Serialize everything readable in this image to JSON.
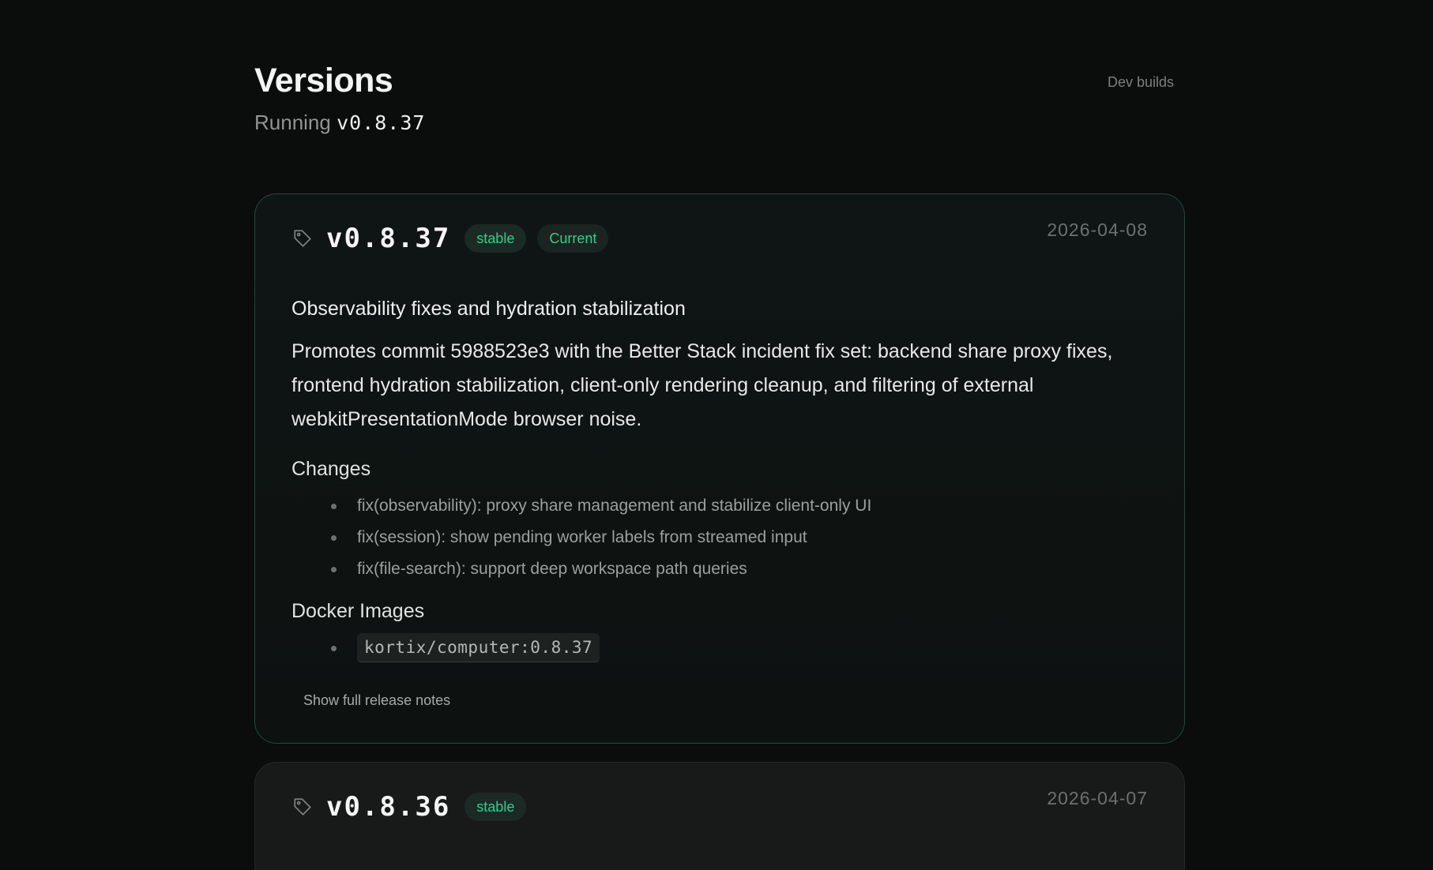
{
  "header": {
    "title": "Versions",
    "running_label": "Running",
    "running_version": "v0.8.37",
    "dev_builds_link": "Dev builds"
  },
  "releases": [
    {
      "version": "v0.8.37",
      "channel_badge": "stable",
      "current_badge": "Current",
      "date": "2026-04-08",
      "summary_title": "Observability fixes and hydration stabilization",
      "summary_text": "Promotes commit 5988523e3 with the Better Stack incident fix set: backend share proxy fixes, frontend hydration stabilization, client-only rendering cleanup, and filtering of external webkitPresentationMode browser noise.",
      "changes_title": "Changes",
      "changes": [
        "fix(observability): proxy share management and stabilize client-only UI",
        "fix(session): show pending worker labels from streamed input",
        "fix(file-search): support deep workspace path queries"
      ],
      "docker_title": "Docker Images",
      "docker_images": [
        "kortix/computer:0.8.37"
      ],
      "show_notes_link": "Show full release notes"
    },
    {
      "version": "v0.8.36",
      "channel_badge": "stable",
      "date": "2026-04-07"
    }
  ],
  "colors": {
    "background": "#0b0c0c",
    "accent": "#2fd08b",
    "current_card_border": "#1e4a3a"
  },
  "icons": {
    "release_tag": "tag-icon"
  }
}
